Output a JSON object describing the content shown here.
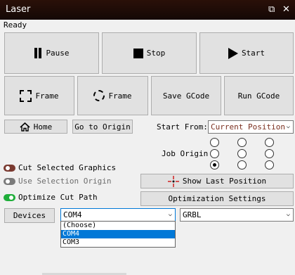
{
  "window": {
    "title": "Laser",
    "restore_glyph": "⧉",
    "close_glyph": "✕"
  },
  "status": "Ready",
  "buttons": {
    "pause": "Pause",
    "stop": "Stop",
    "start": "Start",
    "frame_rect": "Frame",
    "frame_circle": "Frame",
    "save_gcode": "Save GCode",
    "run_gcode": "Run GCode",
    "home": "Home",
    "go_to_origin": "Go to Origin",
    "show_last_position": "Show Last Position",
    "optimization_settings": "Optimization Settings",
    "devices": "Devices"
  },
  "start_from": {
    "label": "Start From:",
    "value": "Current Position"
  },
  "job_origin": {
    "label": "Job Origin",
    "selected": "bottom-left"
  },
  "toggles": [
    {
      "label": "Cut Selected Graphics",
      "state": "off",
      "color": "#7a3a30"
    },
    {
      "label": "Use Selection Origin",
      "state": "off-disabled",
      "color": "#7a7a7a"
    },
    {
      "label": "Optimize Cut Path",
      "state": "on",
      "color": "#1fae3a"
    }
  ],
  "port_select": {
    "value": "COM4",
    "options": [
      "(Choose)",
      "COM4",
      "COM3"
    ],
    "selected_index": 1
  },
  "controller_select": {
    "value": "GRBL"
  },
  "colors": {
    "accent": "#0078d7",
    "title_bar": "#1a0a06",
    "crosshair": "#d02020"
  }
}
